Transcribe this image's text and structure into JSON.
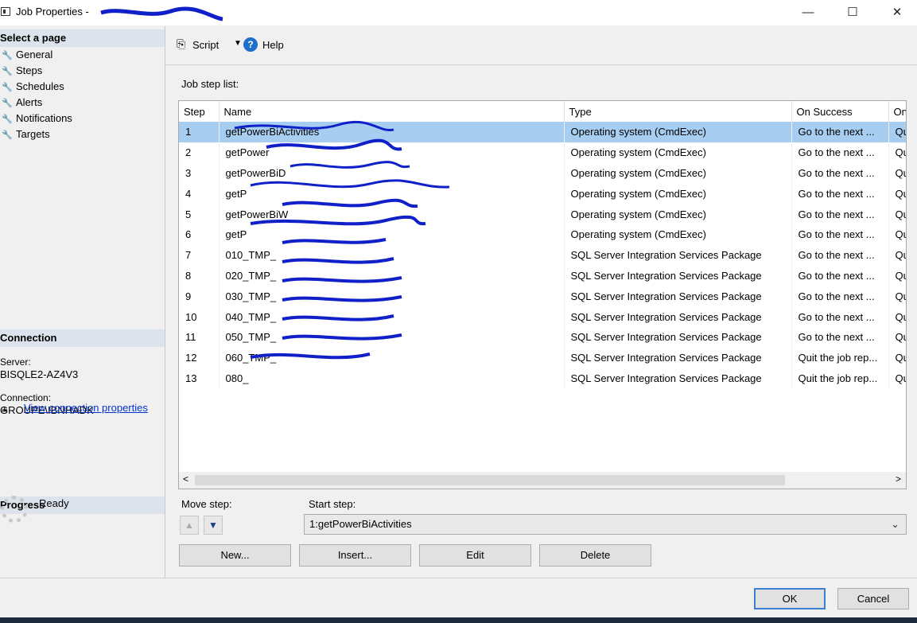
{
  "window": {
    "title": "Job Properties - ",
    "minimize": "—",
    "maximize": "☐",
    "close": "✕"
  },
  "left_pane": {
    "select_page_label": "Select a page",
    "items": [
      {
        "label": "General"
      },
      {
        "label": "Steps"
      },
      {
        "label": "Schedules"
      },
      {
        "label": "Alerts"
      },
      {
        "label": "Notifications"
      },
      {
        "label": "Targets"
      }
    ],
    "connection": {
      "header": "Connection",
      "server_label": "Server:",
      "server_value": "BISQLE2-AZ4V3",
      "connection_label": "Connection:",
      "connection_value": "GROUPE\\IBNHADK",
      "view_link": "View connection properties"
    },
    "progress": {
      "header": "Progress",
      "status": "Ready"
    }
  },
  "toolbar": {
    "script_label": "Script",
    "help_label": "Help"
  },
  "main": {
    "job_step_list_label": "Job step list:",
    "columns": [
      "Step",
      "Name",
      "Type",
      "On Success",
      "On"
    ],
    "rows": [
      {
        "step": "1",
        "name": "getPowerBiActivities",
        "type": "Operating system (CmdExec)",
        "on_success": "Go to the next ...",
        "on_fail": "Qu"
      },
      {
        "step": "2",
        "name": "getPower",
        "type": "Operating system (CmdExec)",
        "on_success": "Go to the next ...",
        "on_fail": "Qu"
      },
      {
        "step": "3",
        "name": "getPowerBiD",
        "type": "Operating system (CmdExec)",
        "on_success": "Go to the next ...",
        "on_fail": "Qu"
      },
      {
        "step": "4",
        "name": "getP",
        "type": "Operating system (CmdExec)",
        "on_success": "Go to the next ...",
        "on_fail": "Qu"
      },
      {
        "step": "5",
        "name": "getPowerBiW",
        "type": "Operating system (CmdExec)",
        "on_success": "Go to the next ...",
        "on_fail": "Qu"
      },
      {
        "step": "6",
        "name": "getP",
        "type": "Operating system (CmdExec)",
        "on_success": "Go to the next ...",
        "on_fail": "Qu"
      },
      {
        "step": "7",
        "name": "010_TMP_",
        "type": "SQL Server Integration Services Package",
        "on_success": "Go to the next ...",
        "on_fail": "Qu"
      },
      {
        "step": "8",
        "name": "020_TMP_",
        "type": "SQL Server Integration Services Package",
        "on_success": "Go to the next ...",
        "on_fail": "Qu"
      },
      {
        "step": "9",
        "name": "030_TMP_",
        "type": "SQL Server Integration Services Package",
        "on_success": "Go to the next ...",
        "on_fail": "Qu"
      },
      {
        "step": "10",
        "name": "040_TMP_",
        "type": "SQL Server Integration Services Package",
        "on_success": "Go to the next ...",
        "on_fail": "Qu"
      },
      {
        "step": "11",
        "name": "050_TMP_",
        "type": "SQL Server Integration Services Package",
        "on_success": "Go to the next ...",
        "on_fail": "Qu"
      },
      {
        "step": "12",
        "name": "060_TMP_",
        "type": "SQL Server Integration Services Package",
        "on_success": "Quit the job rep...",
        "on_fail": "Qu"
      },
      {
        "step": "13",
        "name": "080_",
        "type": "SQL Server Integration Services Package",
        "on_success": "Quit the job rep...",
        "on_fail": "Qu"
      }
    ],
    "move_step_label": "Move step:",
    "start_step_label": "Start step:",
    "start_step_value": "1:getPowerBiActivities",
    "buttons": {
      "new": "New...",
      "insert": "Insert...",
      "edit": "Edit",
      "delete": "Delete"
    }
  },
  "footer": {
    "ok": "OK",
    "cancel": "Cancel"
  },
  "colors": {
    "selection": "#a7cdf0",
    "section_header": "#dde3ec",
    "link": "#0033cc",
    "scribble": "#1020c8"
  }
}
